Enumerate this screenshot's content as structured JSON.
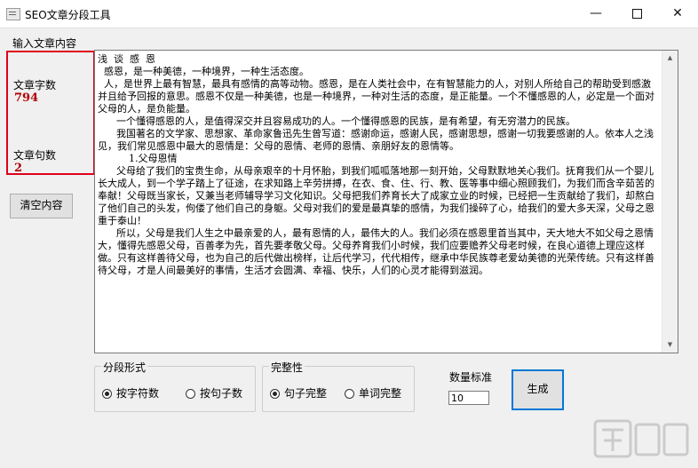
{
  "window": {
    "title": "SEO文章分段工具",
    "minimize": "—",
    "close": "✕"
  },
  "sidebar": {
    "input_label": "输入文章内容",
    "char_label": "文章字数",
    "char_count": "794",
    "sentence_label": "文章句数",
    "sentence_count": "2",
    "clear_button": "清空内容"
  },
  "article": {
    "text": "浅  谈  感  恩\n  感恩，是一种美德，一种境界，一种生活态度。\n  人，是世界上最有智慧，最具有感情的高等动物。感恩，是在人类社会中，在有智慧能力的人，对别人所给自己的帮助受到感激并且给予回报的意思。感恩不仅是一种美德，也是一种境界，一种对生活的态度，是正能量。一个不懂感恩的人，必定是一个面对父母的人，是负能量。\n      一个懂得感恩的人，是值得深交并且容易成功的人。一个懂得感恩的民族，是有希望，有无穷潜力的民族。\n      我国著名的文学家、思想家、革命家鲁迅先生曾写道：感谢命运，感谢人民，感谢思想，感谢一切我要感谢的人。依本人之浅见，我们常见感恩中最大的恩情是：父母的恩情、老师的恩情、亲朋好友的恩情等。\n          1.父母恩情\n      父母给了我们的宝贵生命，从母亲艰辛的十月怀胎，到我们呱呱落地那一刻开始，父母默默地关心我们。抚育我们从一个婴儿长大成人，到一个学子踏上了征途，在求知路上辛劳拼搏，在衣、食、住、行、教、医等事中细心照顾我们，为我们而含辛茹苦的奉献！父母既当家长，又兼当老师辅导学习文化知识。父母把我们养育长大了成家立业的时候，已经把一生贡献给了我们，却熬白了他们自己的头发，佝偻了他们自己的身躯。父母对我们的爱是最真挚的感情，为我们操碎了心，给我们的爱大多天深，父母之恩重于泰山！\n      所以，父母是我们人生之中最亲爱的人，最有恩情的人，最伟大的人。我们必须在感恩里首当其中，天大地大不如父母之恩情大，懂得先感恩父母，百善孝为先，首先要孝敬父母。父母养育我们小时候，我们应要赡养父母老时候，在良心道德上理应这样做。只有这样善待父母，也为自己的后代做出榜样，让后代学习，代代相传，继承中华民族尊老爱幼美德的光荣传统。只有这样善待父母，才是人间最美好的事情，生活才会圆满、幸福、快乐，人们的心灵才能得到滋润。"
  },
  "segment_mode": {
    "title": "分段形式",
    "opt1": "按字符数",
    "opt2": "按句子数",
    "selected": "按字符数"
  },
  "integrity": {
    "title": "完整性",
    "opt1": "句子完整",
    "opt2": "单词完整",
    "selected": "句子完整"
  },
  "quantity": {
    "label": "数量标准",
    "value": "10"
  },
  "generate_button": "生成",
  "colors": {
    "highlight_frame": "#e0001b",
    "count_text": "#b00000",
    "generate_border": "#0078d7"
  }
}
